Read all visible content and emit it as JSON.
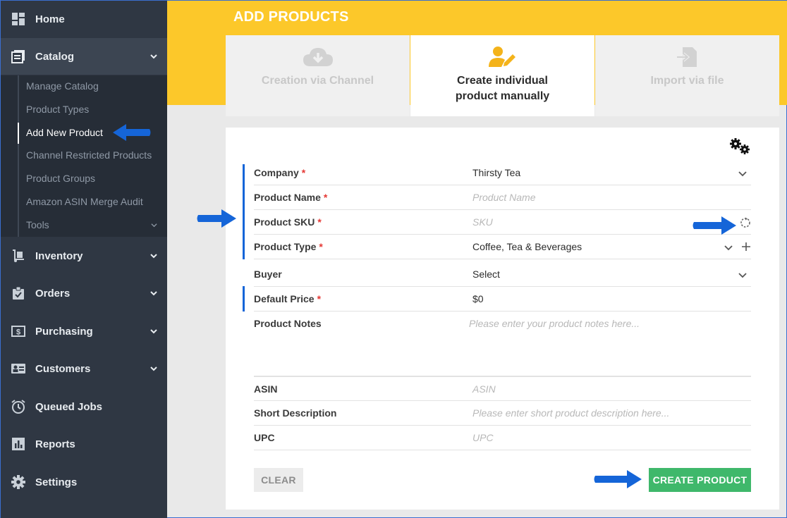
{
  "sidebar": {
    "items": [
      {
        "label": "Home",
        "icon": "dashboard-icon"
      },
      {
        "label": "Catalog",
        "icon": "catalog-icon"
      },
      {
        "label": "Inventory",
        "icon": "inventory-icon"
      },
      {
        "label": "Orders",
        "icon": "orders-icon"
      },
      {
        "label": "Purchasing",
        "icon": "purchasing-icon"
      },
      {
        "label": "Customers",
        "icon": "customers-icon"
      },
      {
        "label": "Queued Jobs",
        "icon": "clock-icon"
      },
      {
        "label": "Reports",
        "icon": "reports-icon"
      },
      {
        "label": "Settings",
        "icon": "gear-icon"
      }
    ],
    "catalog_sub": [
      "Manage Catalog",
      "Product Types",
      "Add New Product",
      "Channel Restricted Products",
      "Product Groups",
      "Amazon ASIN Merge Audit",
      "Tools"
    ]
  },
  "header": {
    "title": "ADD PRODUCTS"
  },
  "tabs": [
    {
      "label": "Creation via Channel",
      "icon": "cloud-download-icon"
    },
    {
      "label": "Create individual product manually",
      "icon": "user-edit-icon"
    },
    {
      "label": "Import via file",
      "icon": "file-import-icon"
    }
  ],
  "form": {
    "company": {
      "label": "Company",
      "value": "Thirsty Tea"
    },
    "product_name": {
      "label": "Product Name",
      "placeholder": "Product Name"
    },
    "product_sku": {
      "label": "Product SKU",
      "placeholder": "SKU"
    },
    "product_type": {
      "label": "Product Type",
      "value": "Coffee, Tea & Beverages"
    },
    "buyer": {
      "label": "Buyer",
      "value": "Select"
    },
    "default_price": {
      "label": "Default Price",
      "value": "$0"
    },
    "product_notes": {
      "label": "Product Notes",
      "placeholder": "Please enter your product notes here..."
    },
    "asin": {
      "label": "ASIN",
      "placeholder": "ASIN"
    },
    "short_description": {
      "label": "Short Description",
      "placeholder": "Please enter short product description here..."
    },
    "upc": {
      "label": "UPC",
      "placeholder": "UPC"
    },
    "required_mark": "*"
  },
  "buttons": {
    "clear": "CLEAR",
    "create": "CREATE PRODUCT"
  },
  "colors": {
    "accent_yellow": "#fcc82a",
    "sidebar_bg": "#2f3743",
    "create_green": "#3fb86b",
    "arrow_blue": "#1565d8"
  }
}
